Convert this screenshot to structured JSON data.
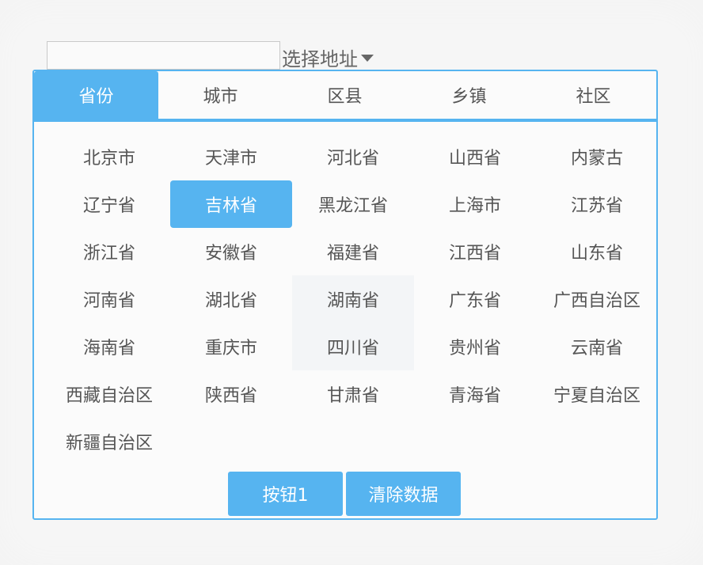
{
  "address": {
    "input_value": "",
    "select_label": "选择地址"
  },
  "tabs": [
    {
      "label": "省份",
      "active": true
    },
    {
      "label": "城市",
      "active": false
    },
    {
      "label": "区县",
      "active": false
    },
    {
      "label": "乡镇",
      "active": false
    },
    {
      "label": "社区",
      "active": false
    }
  ],
  "provinces": [
    "北京市",
    "天津市",
    "河北省",
    "山西省",
    "内蒙古",
    "辽宁省",
    "吉林省",
    "黑龙江省",
    "上海市",
    "江苏省",
    "浙江省",
    "安徽省",
    "福建省",
    "江西省",
    "山东省",
    "河南省",
    "湖北省",
    "湖南省",
    "广东省",
    "广西自治区",
    "海南省",
    "重庆市",
    "四川省",
    "贵州省",
    "云南省",
    "西藏自治区",
    "陕西省",
    "甘肃省",
    "青海省",
    "宁夏自治区",
    "新疆自治区"
  ],
  "selected_province": "吉林省",
  "buttons": {
    "button1_label": "按钮1",
    "clear_label": "清除数据"
  },
  "colors": {
    "accent": "#56b4f0",
    "text": "#555555"
  }
}
